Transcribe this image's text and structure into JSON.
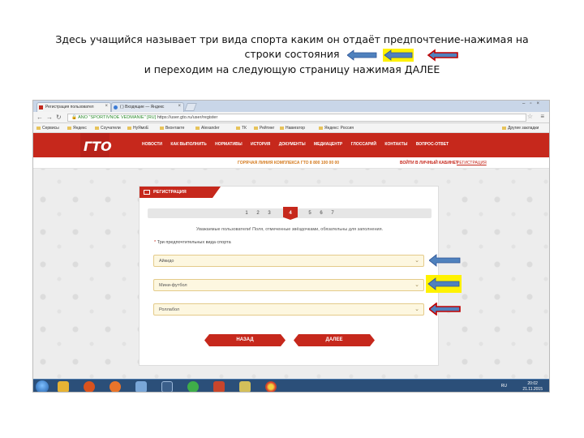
{
  "slide": {
    "caption_line1": "Здесь учащийся называет три вида спорта каким он отдаёт предпочтение-нажимая на",
    "caption_line2": "строки состояния",
    "caption_line3": "и переходим на следующую  страницу нажимая ДАЛЕЕ"
  },
  "browser": {
    "tabs": [
      {
        "label": "Регистрация пользовател"
      },
      {
        "label": "( ) Входящие — Яндекс"
      }
    ],
    "address": {
      "security": "ANO \"SPORTIVNOE VEDMANIE\" [RU]",
      "url": "https://user.gto.ru/user/register"
    },
    "bookmarks": [
      "Сервисы",
      "Яндекс",
      "Соучатели",
      "НуЯмоЕ",
      "Вконтакте",
      "Alexander",
      "ТК",
      "Рейтинг",
      "Навигатор",
      "Яндекс: Россия"
    ],
    "other_bookmarks": "Другие закладки"
  },
  "site": {
    "logo": "ГТО",
    "nav": [
      "НОВОСТИ",
      "КАК ВЫПОЛНИТЬ",
      "НОРМАТИВЫ",
      "ИСТОРИЯ",
      "ДОКУМЕНТЫ",
      "МЕДИАЦЕНТР",
      "ГЛОССАРИЙ",
      "КОНТАКТЫ",
      "ВОПРОС-ОТВЕТ"
    ],
    "hotline": "ГОРЯЧАЯ ЛИНИЯ КОМПЛЕКСА ГТО 8 800 100 00 00",
    "cabinet": "ВОЙТИ В ЛИЧНЫЙ КАБИНЕТ",
    "register_link": "РЕГИСТРАЦИЯ"
  },
  "form": {
    "title": "РЕГИСТРАЦИЯ",
    "steps": [
      "1",
      "2",
      "3",
      "4",
      "5",
      "6",
      "7"
    ],
    "active_step": "4",
    "notice": "Уважаемые пользователи! Поля, отмеченные звёздочками, обязательны для заполнения.",
    "field_label": "Три предпочтительных вида спорта",
    "required_mark": "*",
    "selects": [
      {
        "value": "Айкидо"
      },
      {
        "value": "Мини-футбол"
      },
      {
        "value": "Роллабол"
      }
    ],
    "back_label": "НАЗАД",
    "next_label": "ДАЛЕЕ"
  },
  "annotations": {
    "arrow_colors": [
      "#4f81bd",
      "#f2e600",
      "#c0504d"
    ],
    "arrow_fill": "#4f81bd"
  },
  "taskbar": {
    "lang": "RU",
    "time": "20:02",
    "date": "21.11.2015"
  }
}
